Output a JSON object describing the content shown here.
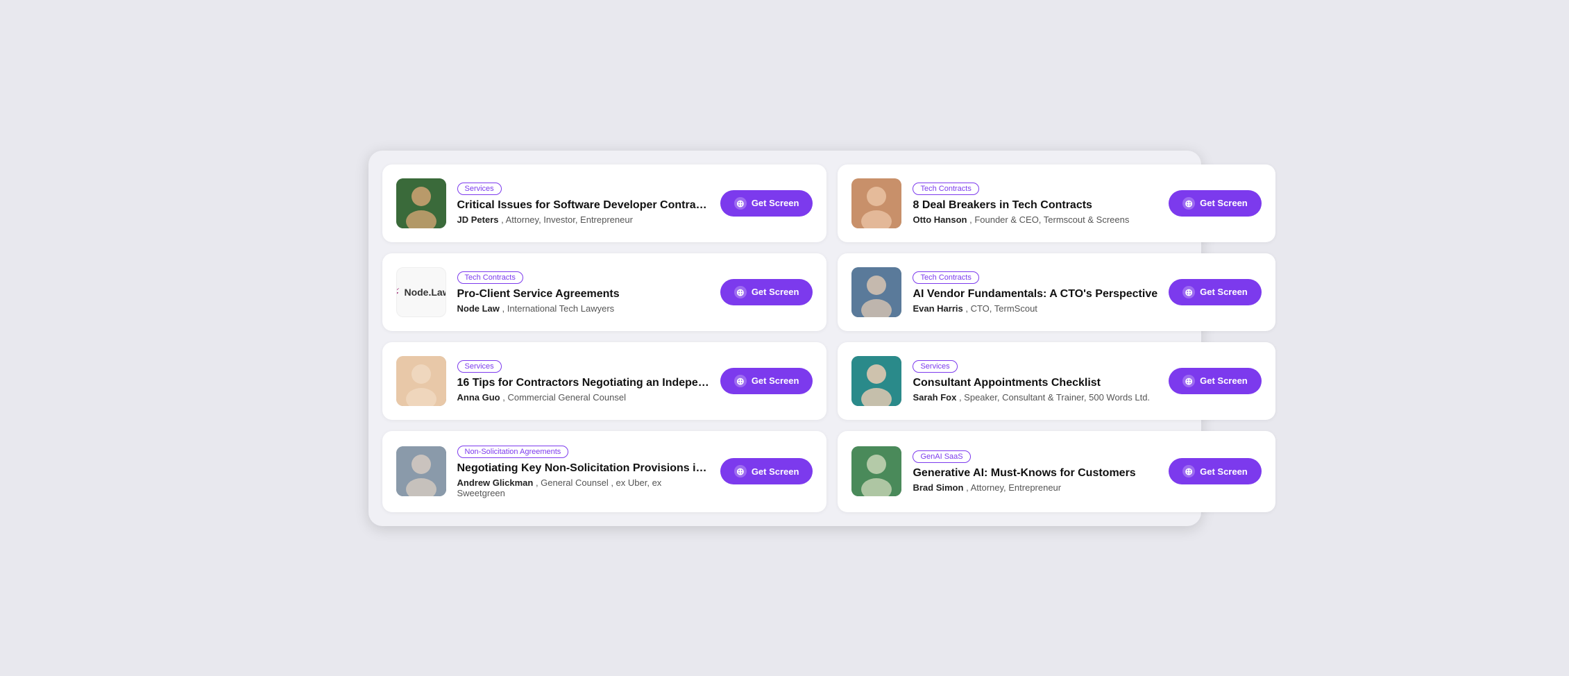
{
  "cards": [
    {
      "id": "card-1",
      "tag": "Services",
      "title": "Critical Issues for Software Developer Contra…",
      "authorName": "JD Peters",
      "authorRole": "Attorney, Investor, Entrepreneur",
      "btnLabel": "Get Screen",
      "avatarClass": "avatar-1",
      "hasNodeLaw": false
    },
    {
      "id": "card-2",
      "tag": "Tech Contracts",
      "title": "8 Deal Breakers in Tech Contracts",
      "authorName": "Otto Hanson",
      "authorRole": "Founder & CEO, Termscout & Screens",
      "btnLabel": "Get Screen",
      "avatarClass": "avatar-2",
      "hasNodeLaw": false
    },
    {
      "id": "card-3",
      "tag": "Tech Contracts",
      "title": "Pro-Client Service Agreements",
      "authorName": "Node Law",
      "authorRole": "International Tech Lawyers",
      "btnLabel": "Get Screen",
      "avatarClass": "avatar-3",
      "hasNodeLaw": true
    },
    {
      "id": "card-4",
      "tag": "Tech Contracts",
      "title": "AI Vendor Fundamentals: A CTO's Perspective",
      "authorName": "Evan Harris",
      "authorRole": "CTO, TermScout",
      "btnLabel": "Get Screen",
      "avatarClass": "avatar-4",
      "hasNodeLaw": false
    },
    {
      "id": "card-5",
      "tag": "Services",
      "title": "16 Tips for Contractors Negotiating an Indepe…",
      "authorName": "Anna Guo",
      "authorRole": "Commercial General Counsel",
      "btnLabel": "Get Screen",
      "avatarClass": "avatar-5",
      "hasNodeLaw": false
    },
    {
      "id": "card-6",
      "tag": "Services",
      "title": "Consultant Appointments Checklist",
      "authorName": "Sarah Fox",
      "authorRole": "Speaker, Consultant & Trainer, 500 Words Ltd.",
      "btnLabel": "Get Screen",
      "avatarClass": "avatar-6",
      "hasNodeLaw": false
    },
    {
      "id": "card-7",
      "tag": "Non-Solicitation Agreements",
      "title": "Negotiating Key Non-Solicitation Provisions i…",
      "authorName": "Andrew Glickman",
      "authorRole": "General Counsel , ex Uber, ex Sweetgreen",
      "btnLabel": "Get Screen",
      "avatarClass": "avatar-7",
      "hasNodeLaw": false
    },
    {
      "id": "card-8",
      "tag": "GenAI SaaS",
      "title": "Generative AI: Must-Knows for Customers",
      "authorName": "Brad Simon",
      "authorRole": "Attorney, Entrepreneur",
      "btnLabel": "Get Screen",
      "avatarClass": "avatar-8",
      "hasNodeLaw": false
    }
  ],
  "btn": {
    "icon": "⊕",
    "label": "Get Screen"
  }
}
